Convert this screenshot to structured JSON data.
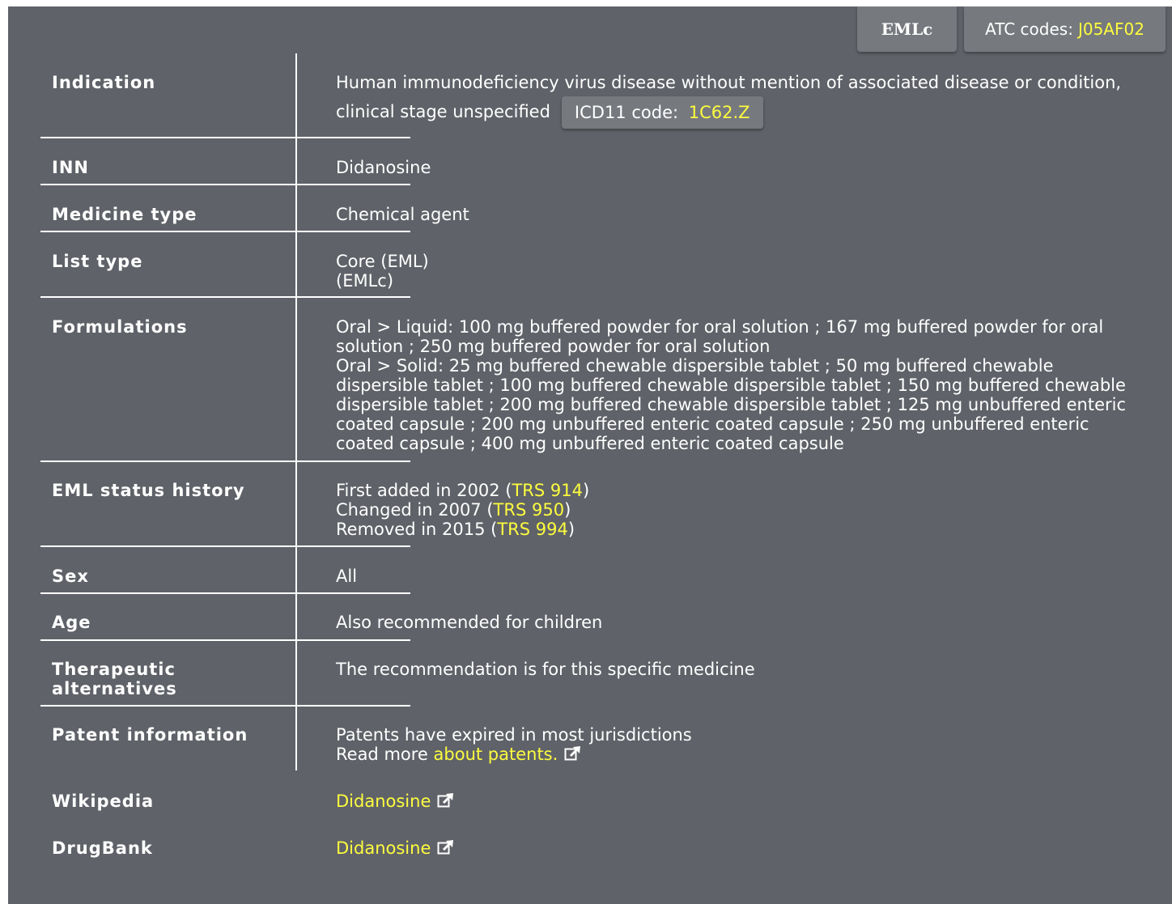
{
  "tags": {
    "list_tag": "EMLc",
    "atc_label": "ATC codes: ",
    "atc_code": "J05AF02"
  },
  "rows": {
    "indication": {
      "label": "Indication",
      "line1": "Human immunodeficiency virus disease without mention of associated disease or condition,",
      "line2": "clinical stage unspecified",
      "icd_label": "ICD11 code: ",
      "icd_code": "1C62.Z"
    },
    "inn": {
      "label": "INN",
      "value": "Didanosine"
    },
    "medicine_type": {
      "label": "Medicine type",
      "value": "Chemical agent"
    },
    "list_type": {
      "label": "List type",
      "line1": "Core (EML)",
      "line2": "(EMLc)"
    },
    "formulations": {
      "label": "Formulations",
      "lines": [
        "Oral > Liquid: 100 mg buffered powder for oral solution ; 167 mg buffered powder for oral",
        "solution ; 250 mg buffered powder for oral solution",
        "Oral > Solid: 25 mg buffered chewable dispersible tablet ; 50 mg buffered chewable",
        "dispersible tablet ; 100 mg buffered chewable dispersible tablet ; 150 mg buffered chewable",
        "dispersible tablet ; 200 mg buffered chewable dispersible tablet ; 125 mg unbuffered enteric",
        "coated capsule ; 200 mg unbuffered enteric coated capsule ; 250 mg unbuffered enteric",
        "coated capsule ; 400 mg unbuffered enteric coated capsule"
      ]
    },
    "eml_status": {
      "label": "EML status history",
      "entries": [
        {
          "text": "First added in 2002 (",
          "link": "TRS 914",
          "close": ")"
        },
        {
          "text": "Changed in 2007 (",
          "link": "TRS 950",
          "close": ")"
        },
        {
          "text": "Removed in 2015 (",
          "link": "TRS 994",
          "close": ")"
        }
      ]
    },
    "sex": {
      "label": "Sex",
      "value": "All"
    },
    "age": {
      "label": "Age",
      "value": "Also recommended for children"
    },
    "therapeutic": {
      "label_line1": "Therapeutic",
      "label_line2": "alternatives",
      "value": "The recommendation is for this specific medicine"
    },
    "patent": {
      "label": "Patent information",
      "line1": "Patents have expired in most jurisdictions",
      "read_more": "Read more ",
      "link": "about patents."
    },
    "wikipedia": {
      "label": "Wikipedia",
      "link": "Didanosine"
    },
    "drugbank": {
      "label": "DrugBank",
      "link": "Didanosine"
    }
  },
  "icons": {
    "external_link": "external-link-icon"
  },
  "colors": {
    "panel": "#5f6268",
    "tag": "#76797e",
    "link": "#fdfc3f",
    "text": "#ffffff"
  }
}
